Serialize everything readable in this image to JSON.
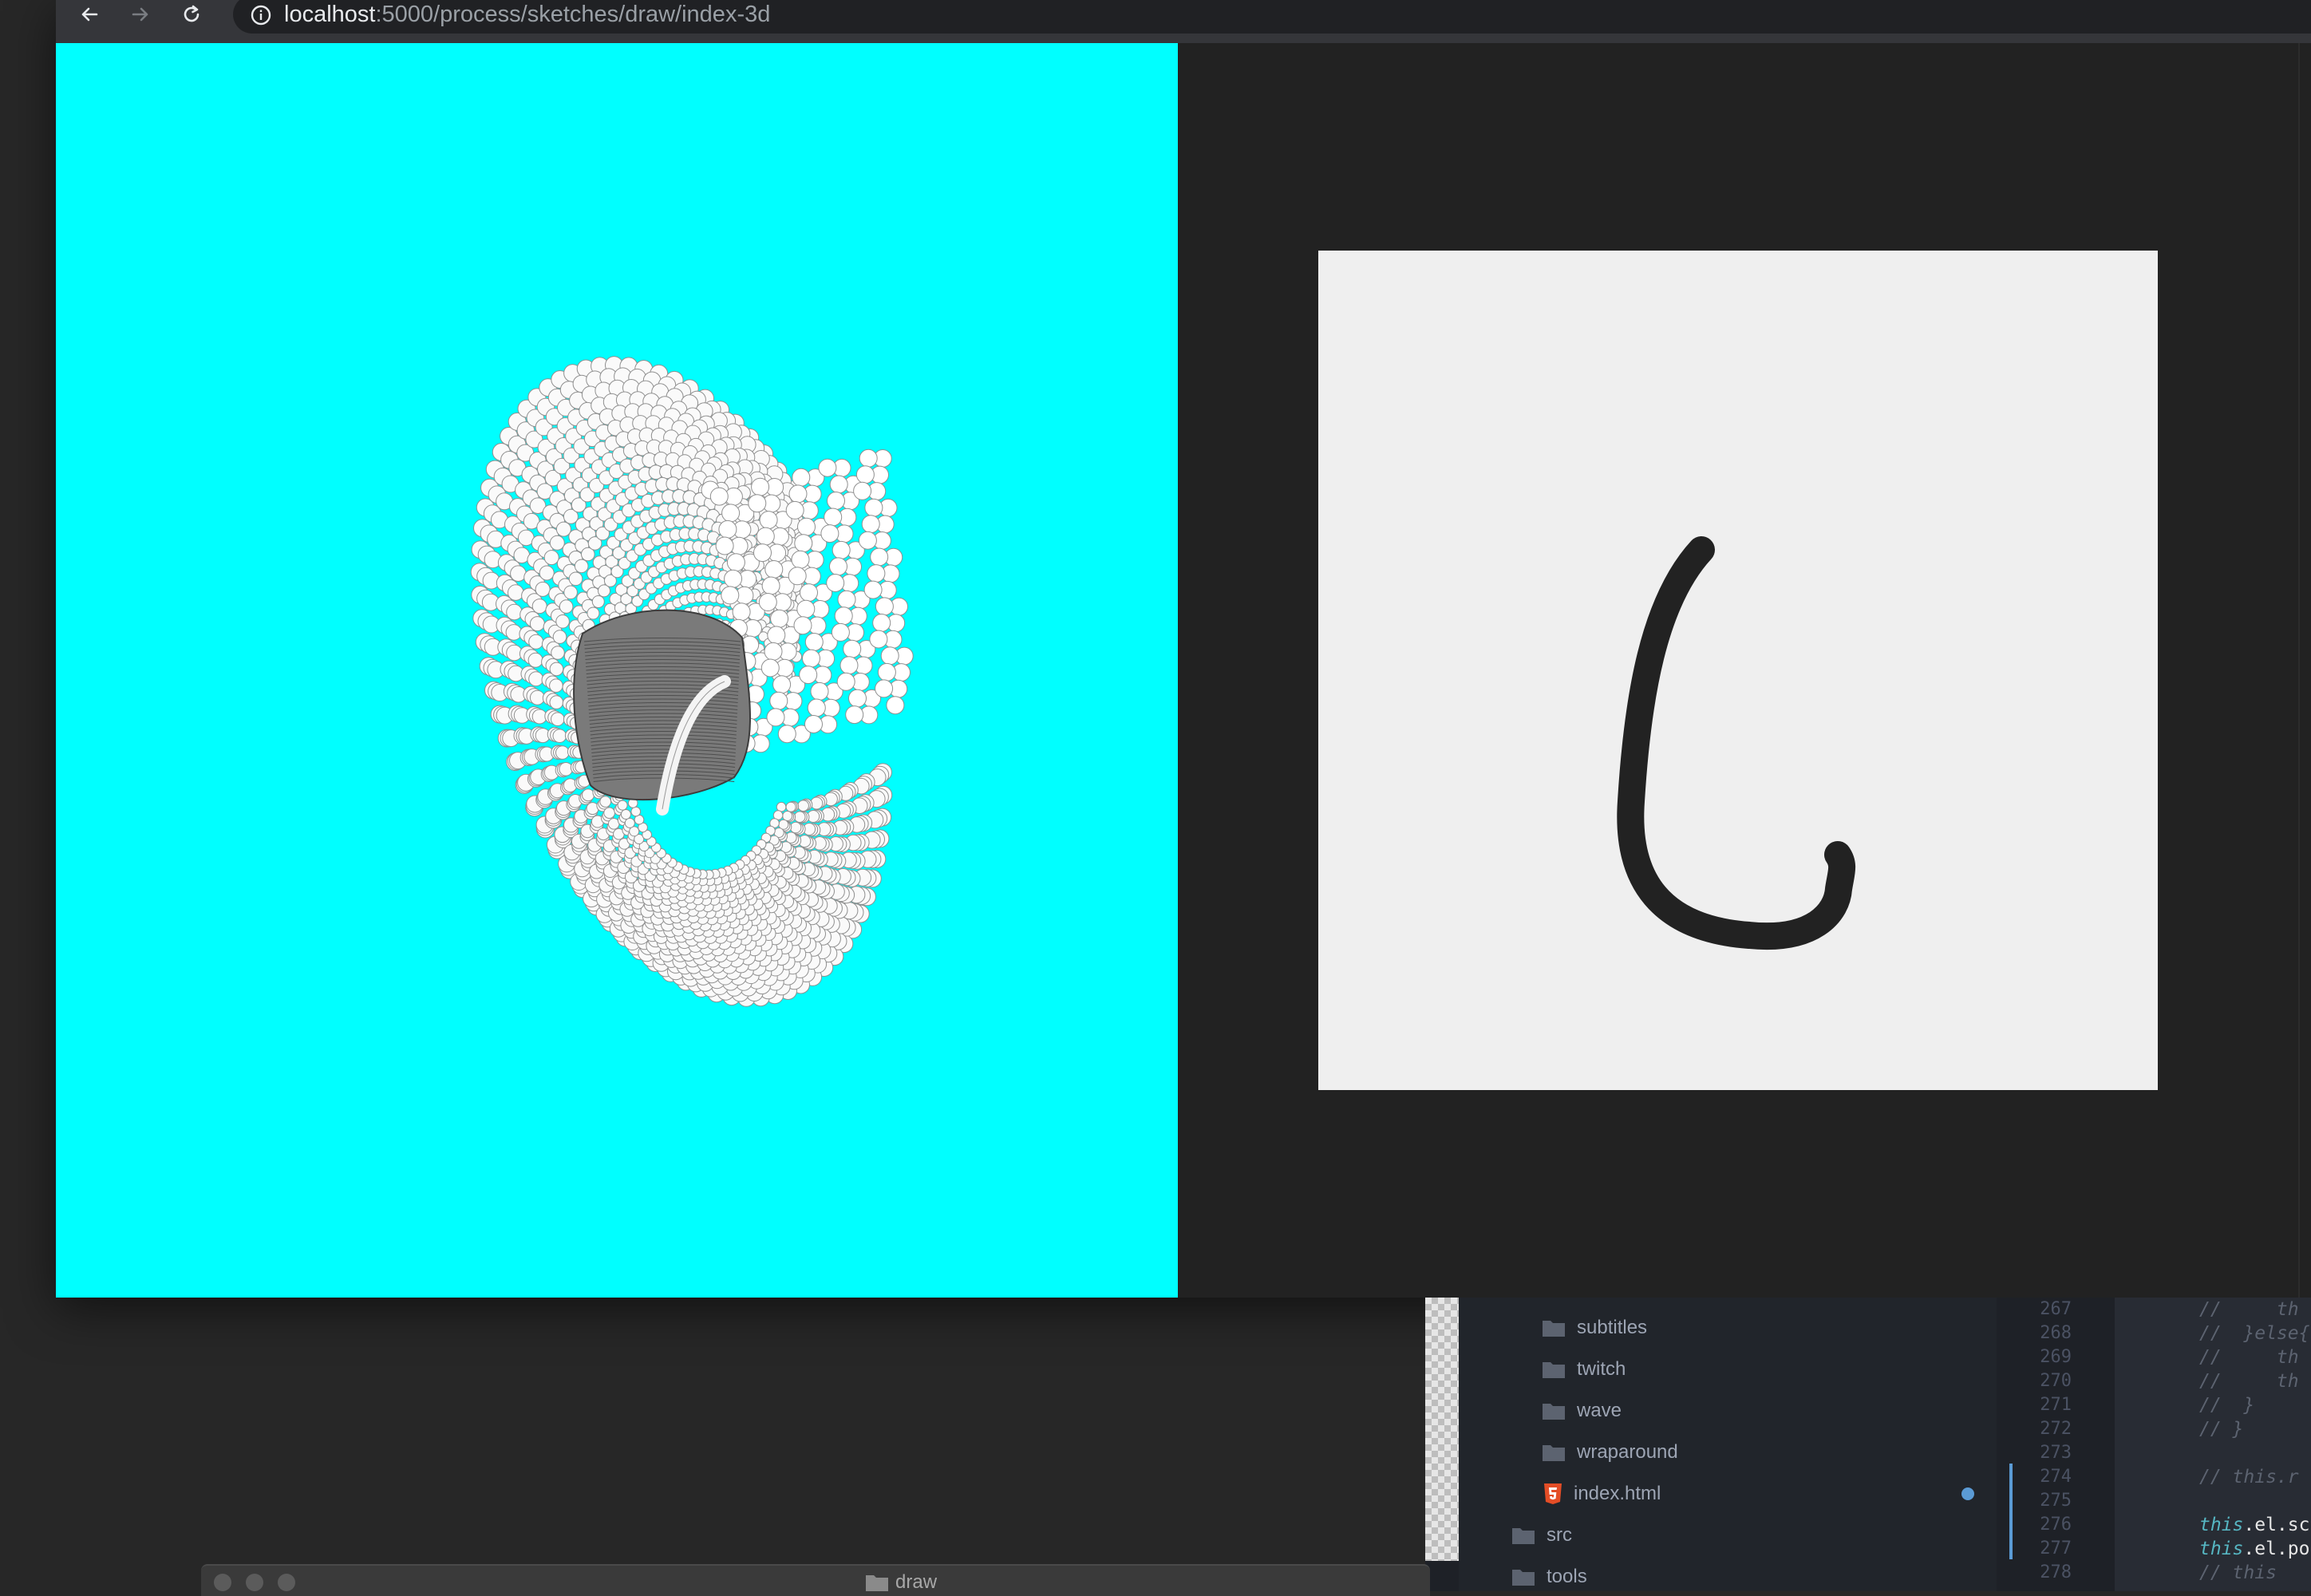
{
  "browser": {
    "url_host": "localhost",
    "url_path": ":5000/process/sketches/draw/index-3d",
    "icons": [
      "back-arrow-icon",
      "forward-arrow-icon",
      "reload-icon",
      "info-icon"
    ],
    "colors": {
      "left_panel": "#00ffff",
      "draw_canvas": "#efefef",
      "stroke": "#222222"
    }
  },
  "editor": {
    "tree_items": [
      {
        "label": "subtitles",
        "icon": "folder-icon"
      },
      {
        "label": "twitch",
        "icon": "folder-icon"
      },
      {
        "label": "wave",
        "icon": "folder-icon"
      },
      {
        "label": "wraparound",
        "icon": "folder-icon"
      },
      {
        "label": "index.html",
        "icon": "html5-file-icon"
      },
      {
        "label": "src",
        "icon": "folder-icon"
      },
      {
        "label": "tools",
        "icon": "folder-icon"
      }
    ],
    "line_numbers": [
      "267",
      "268",
      "269",
      "270",
      "271",
      "272",
      "273",
      "274",
      "275",
      "276",
      "277",
      "278"
    ],
    "code_lines": [
      "//     th",
      "//  }else{",
      "//     th",
      "//     th",
      "//  }",
      "// }",
      "",
      "// this.r",
      "",
      "this.el.sc",
      "this.el.po",
      "// this"
    ]
  },
  "finder": {
    "title": "draw",
    "icons": [
      "folder-icon"
    ]
  }
}
